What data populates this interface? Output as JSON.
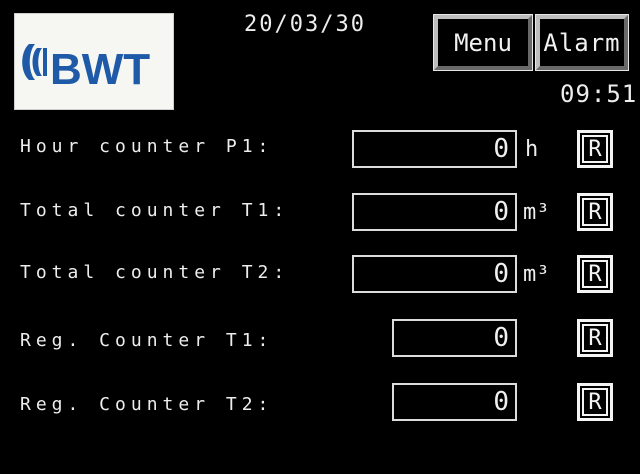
{
  "header": {
    "logo_text": "BWT",
    "date": "20/03/30",
    "menu_label": "Menu",
    "alarm_label": "Alarm",
    "time": "09:51"
  },
  "rows": [
    {
      "label": "Hour counter P1:",
      "value": "0",
      "unit": "h",
      "reset_label": "R"
    },
    {
      "label": "Total counter T1:",
      "value": "0",
      "unit": "m³",
      "reset_label": "R"
    },
    {
      "label": "Total counter T2:",
      "value": "0",
      "unit": "m³",
      "reset_label": "R"
    },
    {
      "label": "Reg. Counter T1:",
      "value": "0",
      "unit": "",
      "reset_label": "R"
    },
    {
      "label": "Reg. Counter T2:",
      "value": "0",
      "unit": "",
      "reset_label": "R"
    }
  ],
  "colors": {
    "background": "#000000",
    "logo_blue": "#1e5aa8",
    "foreground": "#eeeeee"
  }
}
